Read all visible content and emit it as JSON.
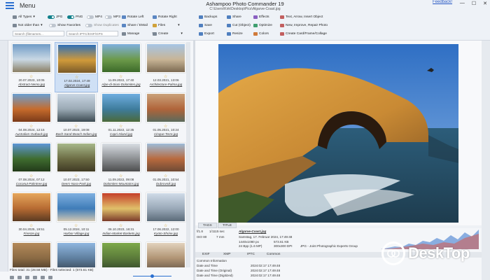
{
  "titlebar": {
    "menu_label": "Menu",
    "app_title": "Ashampoo Photo Commander 19",
    "path": "C:\\Users\\Kirk\\Desktop\\Pics\\Algarve-Coast.jpg",
    "feedback": "Feedback!",
    "min": "—",
    "max": "☐",
    "close": "✕"
  },
  "toolbar": {
    "all_types": "All Types",
    "jpg": "JPG",
    "png": "PNG",
    "mp4": "MP4",
    "mp3": "MP3",
    "not_older": "Not older than",
    "show_favorites": "Show Favorites",
    "show_duplicates": "Show Duplicates",
    "search_filenames": "Search (filenames...",
    "search_iptc": "Search IPTC/EXIF/GPS",
    "rotate_left": "Rotate Left",
    "rotate_right": "Rotate Right",
    "share_email": "Share / EMail",
    "files": "Files",
    "manage": "Manage",
    "create": "Create",
    "backups": "Backups",
    "save": "Save",
    "export": "Export",
    "share": "Share",
    "cut_object": "Cut (Object)",
    "resize": "Resize",
    "effects": "Effects",
    "optimize": "Optimize",
    "colors": "Colors",
    "text_arrow": "Text, Arrow, Insert Object",
    "new_improve": "New, Improve, Repair Photo",
    "create_card": "Create Card/Frame/Collage"
  },
  "thumbnails": [
    {
      "date": "20.07.2023, 10:05",
      "file": "Abstract-Nemo.jpg",
      "colors": [
        "#6f9bc6",
        "#c9d8e4",
        "#8a7f64"
      ]
    },
    {
      "date": "17.02.2024, 17:49",
      "file": "Algarve-Coast.jpg",
      "colors": [
        "#2f6fb8",
        "#d09a3a",
        "#7a5a2a"
      ],
      "selected": true
    },
    {
      "date": "11.09.2022, 17:40",
      "file": "Alpe-di-Siusi-Dolomites.jpg",
      "colors": [
        "#7fb0de",
        "#6c9a4a",
        "#3c6a2a"
      ]
    },
    {
      "date": "12.03.2021, 13:06",
      "file": "Architecture-Palma.jpg",
      "colors": [
        "#a6c5e5",
        "#c8b596",
        "#7c6a52"
      ]
    },
    {
      "date": "04.08.2024, 12:15",
      "file": "Australien-Outback.jpg",
      "colors": [
        "#6aa0d2",
        "#c66b2c",
        "#7a3a1a"
      ]
    },
    {
      "date": "10.07.2023, 19:08",
      "file": "Bash-Sand-Beach-Indien.jpg",
      "colors": [
        "#c9d6e3",
        "#9aa9b4",
        "#3c4a52"
      ]
    },
    {
      "date": "01.11.2022, 12:35",
      "file": "Capri-Island.jpg",
      "colors": [
        "#6faee0",
        "#3e7c9c",
        "#4b6a3a"
      ]
    },
    {
      "date": "01.05.2021, 10:24",
      "file": "Cinque-Terre.jpg",
      "colors": [
        "#caa27a",
        "#b0643a",
        "#5a6a5c"
      ]
    },
    {
      "date": "07.08.2024, 07:12",
      "file": "Coconut-Palmtree.jpg",
      "colors": [
        "#5d96d6",
        "#3f6c2f",
        "#223a1a"
      ]
    },
    {
      "date": "10.07.2023, 17:50",
      "file": "Deers-Nara-Park.jpg",
      "colors": [
        "#a7b88a",
        "#6c6c44",
        "#3f3a24"
      ]
    },
    {
      "date": "11.09.2022, 09:08",
      "file": "Dolomites-Mountains.jpg",
      "colors": [
        "#d8dde3",
        "#8c8f92",
        "#4c4d4e"
      ]
    },
    {
      "date": "01.05.2021, 10:54",
      "file": "Dubrovnik.jpg",
      "colors": [
        "#9dbcd8",
        "#b86a3e",
        "#6e4a36"
      ]
    },
    {
      "date": "30.04.2025, 19:51",
      "file": "Firenze.jpg",
      "colors": [
        "#e6a75c",
        "#b66a32",
        "#5a3a22"
      ]
    },
    {
      "date": "05.12.2024, 10:11",
      "file": "Harbor-Village.jpg",
      "colors": [
        "#7fb0e0",
        "#3f7cb8",
        "#d2c8b4"
      ]
    },
    {
      "date": "06.10.2023, 16:31",
      "file": "Indian-Market-Baskets.jpg",
      "colors": [
        "#c43e2a",
        "#e0c06a",
        "#7a3a2a"
      ]
    },
    {
      "date": "17.06.2022, 12:00",
      "file": "Kyoto-Shrine.jpg",
      "colors": [
        "#cfdbe8",
        "#9aa9b8",
        "#5a6a78"
      ]
    },
    {
      "date": "",
      "file": "",
      "colors": [
        "#b48a5a",
        "#8a6a44",
        "#4a3a2a"
      ]
    },
    {
      "date": "",
      "file": "",
      "colors": [
        "#8fb6df",
        "#5f7f9f",
        "#3a4a5a"
      ]
    },
    {
      "date": "",
      "file": "",
      "colors": [
        "#7ea94a",
        "#5a7a3a",
        "#34482a"
      ]
    },
    {
      "date": "",
      "file": "",
      "colors": [
        "#e2d2bd",
        "#b09474",
        "#6a5a4a"
      ]
    }
  ],
  "status": {
    "files_total": "Files total: 31 (28.58 MB) - Files selected: 1 (573.61 KB)"
  },
  "info": {
    "tab_tags": "TAGS",
    "tab_title": "TITLE",
    "aperture": "f/1.8",
    "shutter": "1/1115 sec",
    "iso": "ISO 80",
    "focal": "7 mm",
    "filename": "Algarve-Coast.jpg",
    "date_long": "Samstag, 17. Februar 2024, 17:49:48",
    "dimensions": "1440x1080 px",
    "size": "573.61 KB",
    "bpp": "24 Bpp (1.6 MP)",
    "dpi": "300x300 DPI",
    "format": "JPG - Joint Photographic Experts Group",
    "exif_tab": "EXIF",
    "xmp_tab": "XMP",
    "iptc_tab": "IPTC",
    "common_tab": "Common",
    "rows": [
      {
        "label": "Common Information",
        "value": ""
      },
      {
        "label": "Date and Time",
        "value": "2024:02:17 17:49:48"
      },
      {
        "label": "Date and Time (Original)",
        "value": "2024:02:17 17:49:48"
      },
      {
        "label": "Date and Time (Digitized)",
        "value": "2024:02:17 17:49:48"
      }
    ]
  },
  "watermark": {
    "text": "DeskTop"
  },
  "colors": {
    "accent": "#2a6fd0",
    "toggle": "#12808b",
    "selection": "#cfe0f5"
  }
}
